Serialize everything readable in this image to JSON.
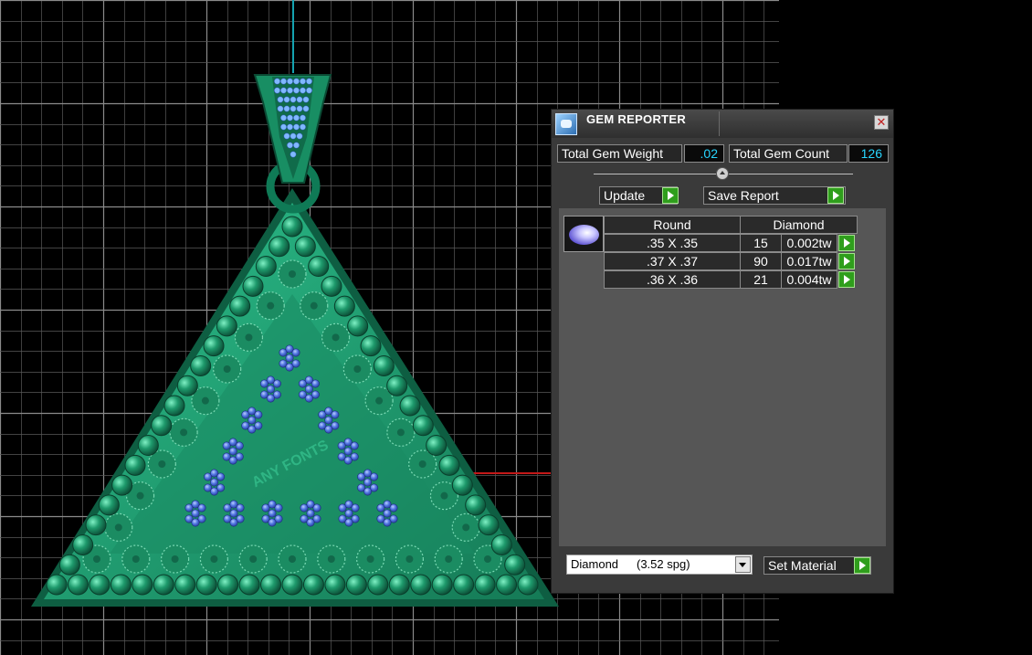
{
  "viewport": {
    "background_color": "#000000",
    "grid_color": "#5a5a5a",
    "pendant_color": "#1f9a70",
    "gem_color": "#4f74e0",
    "pendant_engraving": "ANY FONTS"
  },
  "gem_reporter": {
    "title": "GEM REPORTER",
    "close_glyph": "✕",
    "total_gem_weight_label": "Total Gem Weight",
    "total_gem_weight_value": ".02",
    "total_gem_count_label": "Total Gem Count",
    "total_gem_count_value": "126",
    "update_label": "Update",
    "save_report_label": "Save Report",
    "table": {
      "headers": [
        "Round",
        "Diamond"
      ],
      "rows": [
        {
          "size": ".35 X .35",
          "count": "15",
          "weight": "0.002tw"
        },
        {
          "size": ".37 X .37",
          "count": "90",
          "weight": "0.017tw"
        },
        {
          "size": ".36 X .36",
          "count": "21",
          "weight": "0.004tw"
        }
      ]
    },
    "material": {
      "name": "Diamond",
      "spg": "(3.52 spg)"
    },
    "set_material_label": "Set Material",
    "accent_color": "#2f9e1c",
    "value_color": "#28d6ff"
  }
}
